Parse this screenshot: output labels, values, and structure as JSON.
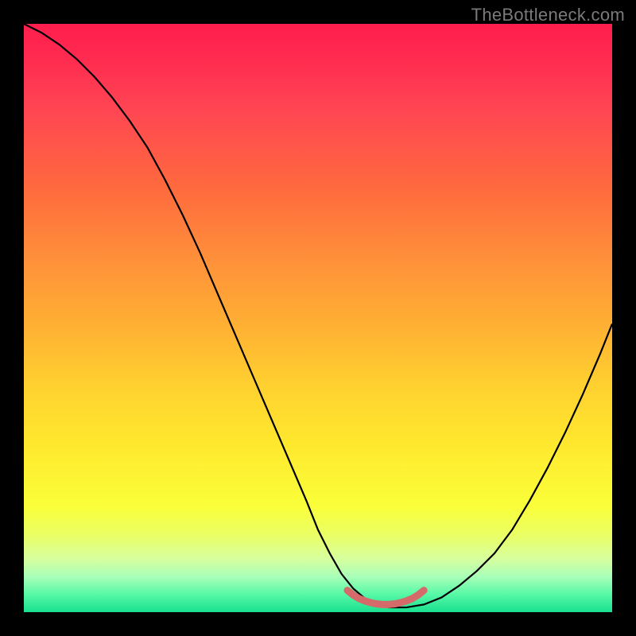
{
  "watermark": "TheBottleneck.com",
  "chart_data": {
    "type": "line",
    "title": "",
    "xlabel": "",
    "ylabel": "",
    "xlim": [
      0,
      100
    ],
    "ylim": [
      0,
      100
    ],
    "grid": false,
    "series": [
      {
        "name": "bottleneck-curve",
        "color": "#000000",
        "width": 2.2,
        "x": [
          0,
          3,
          6,
          9,
          12,
          15,
          18,
          21,
          24,
          27,
          30,
          33,
          36,
          39,
          42,
          45,
          48,
          50,
          52,
          54,
          56,
          58,
          60,
          62,
          65,
          68,
          71,
          74,
          77,
          80,
          83,
          86,
          89,
          92,
          95,
          98,
          100
        ],
        "values": [
          100,
          98.5,
          96.5,
          94,
          91,
          87.5,
          83.5,
          79,
          73.5,
          67.5,
          61,
          54,
          47,
          40,
          33,
          26,
          19,
          14,
          10,
          6.5,
          4,
          2.3,
          1.3,
          0.8,
          0.8,
          1.3,
          2.5,
          4.5,
          7,
          10,
          14,
          19,
          24.5,
          30.5,
          37,
          44,
          49
        ]
      },
      {
        "name": "optimal-range-marker",
        "color": "#d46a6a",
        "width": 9,
        "linecap": "round",
        "x": [
          55,
          56,
          57,
          58,
          59,
          60,
          61,
          62,
          63,
          64,
          65,
          66,
          67,
          68
        ],
        "values": [
          3.7,
          2.9,
          2.3,
          1.9,
          1.6,
          1.4,
          1.3,
          1.3,
          1.4,
          1.6,
          1.9,
          2.3,
          2.9,
          3.7
        ]
      }
    ]
  }
}
